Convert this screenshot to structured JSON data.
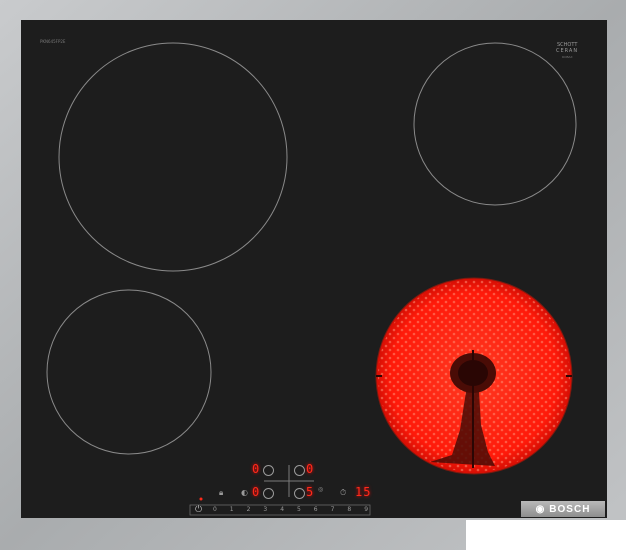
{
  "product": {
    "model_code": "PKN645FP2E",
    "glass_brand": "SCHOTT",
    "glass_line": "CERAN",
    "glass_sub": "ROBAX",
    "brand": "BOSCH",
    "brand_icon": "bosch-logo-icon"
  },
  "displays": {
    "zone_rear_left": "0",
    "zone_rear_right": "0",
    "zone_front_left": "0",
    "zone_front_right": "5",
    "timer": "15"
  },
  "slider_scale": [
    "0",
    "1",
    "2",
    "3",
    "4",
    "5",
    "6",
    "7",
    "8",
    "9"
  ],
  "colors": {
    "frame": "#b5b8bb",
    "glass": "#1d1d1d",
    "zone_outline": "#8a8a8a",
    "heat": "#ff1a0a",
    "display": "#ff2a1a"
  },
  "active_zone": "front-right"
}
